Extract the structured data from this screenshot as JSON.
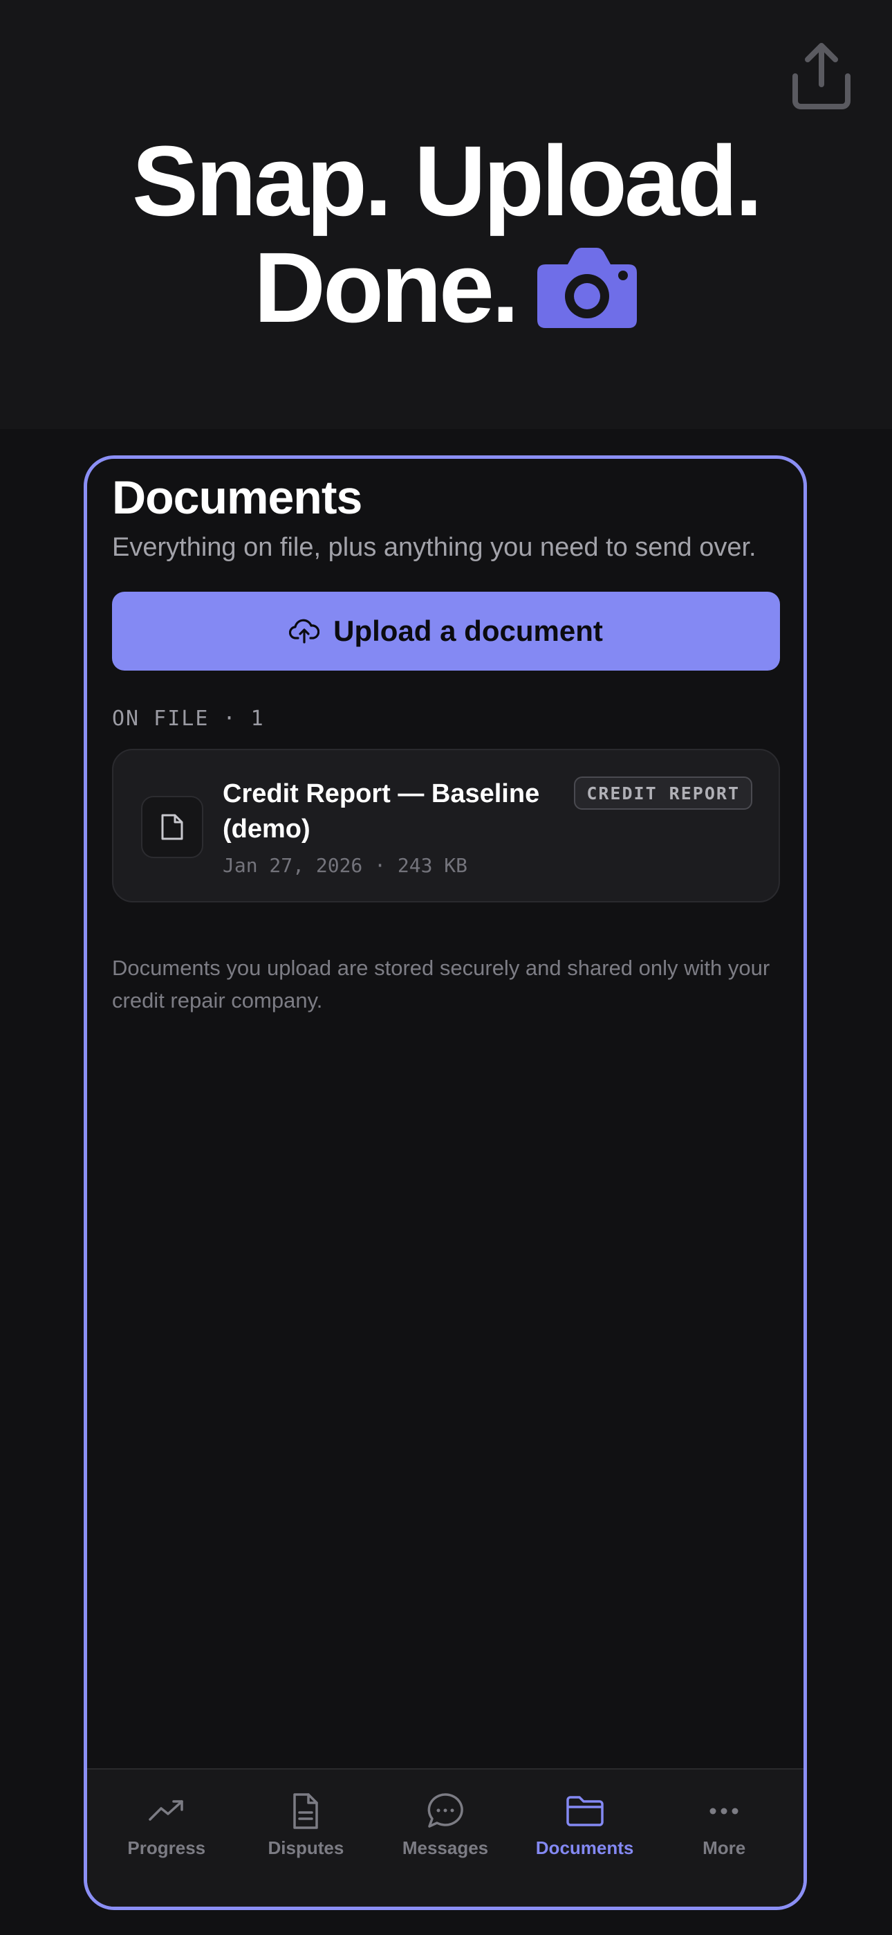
{
  "hero": {
    "line1": "Snap. Upload.",
    "line2": "Done.",
    "camera_icon": "camera-icon",
    "share_icon": "share-icon"
  },
  "page": {
    "title": "Documents",
    "subtitle": "Everything on file, plus anything you need to send over.",
    "upload_button": "Upload a document",
    "section_label": "ON FILE · 1",
    "footnote": "Documents you upload are stored securely and shared only with your credit repair company."
  },
  "documents": [
    {
      "name": "Credit Report — Baseline (demo)",
      "meta": "Jan 27, 2026 · 243 KB",
      "badge": "CREDIT REPORT",
      "icon": "file-icon"
    }
  ],
  "tabs": [
    {
      "label": "Progress",
      "icon": "trending-up-icon",
      "active": false
    },
    {
      "label": "Disputes",
      "icon": "document-icon",
      "active": false
    },
    {
      "label": "Messages",
      "icon": "chat-bubble-icon",
      "active": false
    },
    {
      "label": "Documents",
      "icon": "folder-icon",
      "active": true
    },
    {
      "label": "More",
      "icon": "more-dots-icon",
      "active": false
    }
  ],
  "colors": {
    "accent": "#8489f3",
    "background": "#111113",
    "border": "#8b8ff5"
  }
}
